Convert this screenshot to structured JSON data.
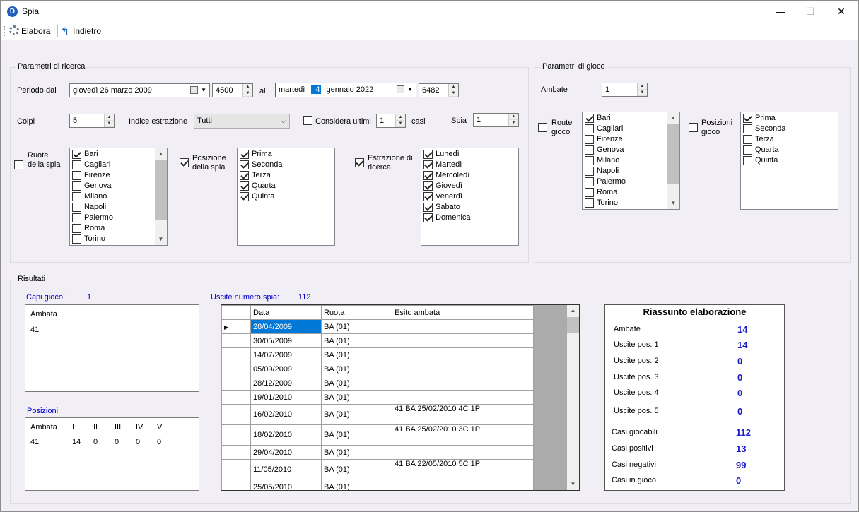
{
  "window": {
    "title": "Spia",
    "app_icon_letter": "D",
    "minimize": "—",
    "maximize": "☐",
    "close": "✕"
  },
  "toolbar": {
    "elabora": "Elabora",
    "indietro": "Indietro"
  },
  "ricerca": {
    "title": "Parametri di ricerca",
    "periodo_label": "Periodo dal",
    "date_from": "giovedì   26    marzo    2009",
    "num_from": "4500",
    "al_label": "al",
    "date_to_pre": "martedì",
    "date_to_sel": "4",
    "date_to_post": "gennaio   2022",
    "num_to": "6482",
    "colpi_label": "Colpi",
    "colpi_value": "5",
    "indice_label": "Indice estrazione",
    "indice_value": "Tutti",
    "considera_label": "Considera ultimi",
    "considera_value": "1",
    "casi_label": "casi",
    "spia_label": "Spia",
    "spia_value": "1",
    "ruote_label": "Ruote della spia",
    "ruote": [
      {
        "name": "Bari",
        "checked": true
      },
      {
        "name": "Cagliari",
        "checked": false
      },
      {
        "name": "Firenze",
        "checked": false
      },
      {
        "name": "Genova",
        "checked": false
      },
      {
        "name": "Milano",
        "checked": false
      },
      {
        "name": "Napoli",
        "checked": false
      },
      {
        "name": "Palermo",
        "checked": false
      },
      {
        "name": "Roma",
        "checked": false
      },
      {
        "name": "Torino",
        "checked": false
      }
    ],
    "posizione_label": "Posizione della spia",
    "posizioni": [
      {
        "name": "Prima",
        "checked": true
      },
      {
        "name": "Seconda",
        "checked": true
      },
      {
        "name": "Terza",
        "checked": true
      },
      {
        "name": "Quarta",
        "checked": true
      },
      {
        "name": "Quinta",
        "checked": true
      }
    ],
    "estrazione_label": "Estrazione di ricerca",
    "giorni": [
      {
        "name": "Lunedì",
        "checked": true
      },
      {
        "name": "Martedì",
        "checked": true
      },
      {
        "name": "Mercoledì",
        "checked": true
      },
      {
        "name": "Giovedì",
        "checked": true
      },
      {
        "name": "Venerdì",
        "checked": true
      },
      {
        "name": "Sabato",
        "checked": true
      },
      {
        "name": "Domenica",
        "checked": true
      }
    ]
  },
  "gioco": {
    "title": "Parametri di gioco",
    "ambate_label": "Ambate",
    "ambate_value": "1",
    "ruote_label": "Route gioco",
    "ruote": [
      {
        "name": "Bari",
        "checked": true
      },
      {
        "name": "Cagliari",
        "checked": false
      },
      {
        "name": "Firenze",
        "checked": false
      },
      {
        "name": "Genova",
        "checked": false
      },
      {
        "name": "Milano",
        "checked": false
      },
      {
        "name": "Napoli",
        "checked": false
      },
      {
        "name": "Palermo",
        "checked": false
      },
      {
        "name": "Roma",
        "checked": false
      },
      {
        "name": "Torino",
        "checked": false
      }
    ],
    "posizioni_label": "Posizioni gioco",
    "posizioni": [
      {
        "name": "Prima",
        "checked": true
      },
      {
        "name": "Seconda",
        "checked": false
      },
      {
        "name": "Terza",
        "checked": false
      },
      {
        "name": "Quarta",
        "checked": false
      },
      {
        "name": "Quinta",
        "checked": false
      }
    ]
  },
  "risultati": {
    "title": "Risultati",
    "capi_label": "Capi gioco:",
    "capi_value": "1",
    "capi_header": "Ambata",
    "capi_values": [
      "41"
    ],
    "posizioni_label": "Posizioni",
    "posizioni_headers": [
      "Ambata",
      "I",
      "II",
      "III",
      "IV",
      "V"
    ],
    "posizioni_row": [
      "41",
      "14",
      "0",
      "0",
      "0",
      "0"
    ],
    "uscite_label": "Uscite numero spia:",
    "uscite_value": "112",
    "grid_headers": [
      "Data",
      "Ruota",
      "Esito ambata"
    ],
    "grid_rows": [
      {
        "data": "28/04/2009",
        "ruota": "BA (01)",
        "esito": ""
      },
      {
        "data": "30/05/2009",
        "ruota": "BA (01)",
        "esito": ""
      },
      {
        "data": "14/07/2009",
        "ruota": "BA (01)",
        "esito": ""
      },
      {
        "data": "05/09/2009",
        "ruota": "BA (01)",
        "esito": ""
      },
      {
        "data": "28/12/2009",
        "ruota": "BA (01)",
        "esito": ""
      },
      {
        "data": "19/01/2010",
        "ruota": "BA (01)",
        "esito": ""
      },
      {
        "data": "16/02/2010",
        "ruota": "BA (01)",
        "esito": "41 BA  25/02/2010  4C 1P"
      },
      {
        "data": "18/02/2010",
        "ruota": "BA (01)",
        "esito": "41 BA  25/02/2010  3C 1P"
      },
      {
        "data": "29/04/2010",
        "ruota": "BA (01)",
        "esito": ""
      },
      {
        "data": "11/05/2010",
        "ruota": "BA (01)",
        "esito": "41 BA  22/05/2010  5C 1P"
      },
      {
        "data": "25/05/2010",
        "ruota": "BA (01)",
        "esito": ""
      }
    ],
    "riassunto": {
      "title": "Riassunto elaborazione",
      "rows": [
        {
          "label": "Ambate",
          "value": "14"
        },
        {
          "label": "Uscite pos. 1",
          "value": "14"
        },
        {
          "label": "Uscite pos. 2",
          "value": "0"
        },
        {
          "label": "Uscite pos. 3",
          "value": "0"
        },
        {
          "label": "Uscite pos. 4",
          "value": "0"
        },
        {
          "label": "Uscite pos. 5",
          "value": "0"
        },
        {
          "label": "Casi giocabili",
          "value": "112"
        },
        {
          "label": "Casi positivi",
          "value": "13"
        },
        {
          "label": "Casi negativi",
          "value": "99"
        },
        {
          "label": "Casi in gioco",
          "value": "0"
        }
      ]
    }
  }
}
